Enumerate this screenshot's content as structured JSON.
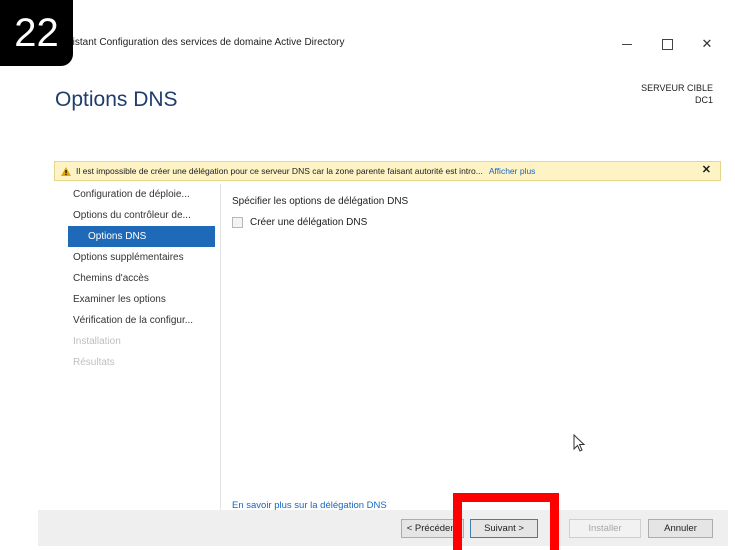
{
  "step": "22",
  "window": {
    "title": "Assistant Configuration des services de domaine Active Directory",
    "controls": {
      "minimize": "–",
      "close": "✕"
    }
  },
  "header": {
    "page_title": "Options DNS",
    "target_label": "SERVEUR CIBLE",
    "target_name": "DC1"
  },
  "warning": {
    "icon": "warning-triangle-icon",
    "text": "Il est impossible de créer une délégation pour ce serveur DNS car la zone parente faisant autorité est intro...",
    "link": "Afficher plus",
    "close": "✕",
    "color": "#fdf3c5"
  },
  "nav": {
    "items": [
      {
        "label": "Configuration de déploie..."
      },
      {
        "label": "Options du contrôleur de..."
      },
      {
        "label": "Options DNS"
      },
      {
        "label": "Options supplémentaires"
      },
      {
        "label": "Chemins d'accès"
      },
      {
        "label": "Examiner les options"
      },
      {
        "label": "Vérification de la configur..."
      },
      {
        "label": "Installation"
      },
      {
        "label": "Résultats"
      }
    ],
    "active_color": "#1f6ab8"
  },
  "content": {
    "heading": "Spécifier les options de délégation DNS",
    "checkbox_label": "Créer une délégation DNS",
    "learn_more": "En savoir plus sur la délégation DNS"
  },
  "footer": {
    "prev": "< Précédent",
    "next": "Suivant >",
    "install": "Installer",
    "cancel": "Annuler"
  },
  "highlight_color": "#ff0000"
}
